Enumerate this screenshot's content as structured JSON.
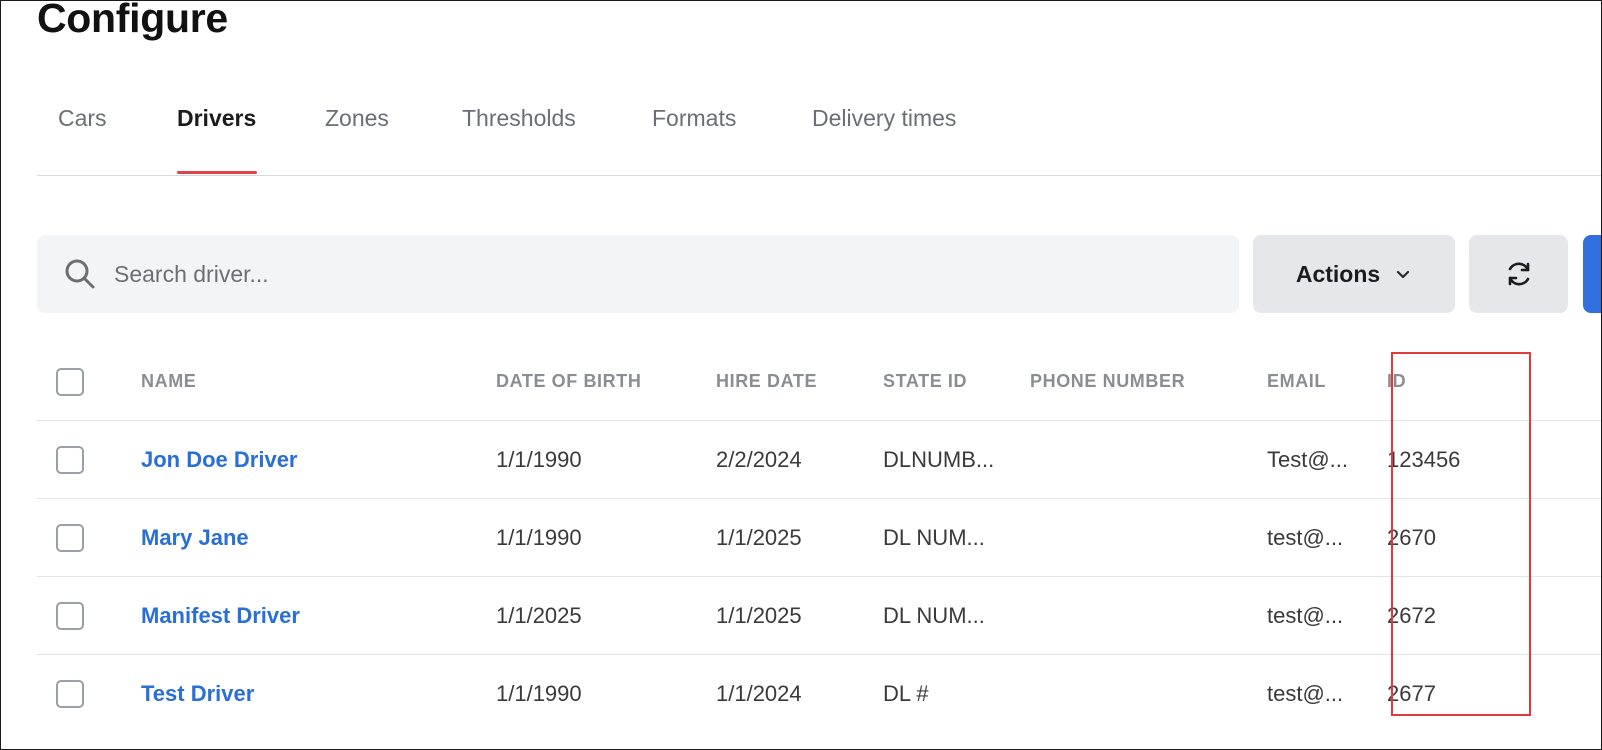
{
  "page": {
    "title": "Configure"
  },
  "tabs": [
    {
      "label": "Cars"
    },
    {
      "label": "Drivers",
      "active": true
    },
    {
      "label": "Zones"
    },
    {
      "label": "Thresholds"
    },
    {
      "label": "Formats"
    },
    {
      "label": "Delivery times"
    }
  ],
  "toolbar": {
    "search_placeholder": "Search driver...",
    "search_value": "",
    "actions_label": "Actions",
    "icons": {
      "search": "search-icon",
      "actions": "chevron-down-icon",
      "refresh": "refresh-icon"
    }
  },
  "table": {
    "columns": [
      "NAME",
      "DATE OF BIRTH",
      "HIRE DATE",
      "STATE ID",
      "PHONE NUMBER",
      "EMAIL",
      "ID"
    ],
    "rows": [
      {
        "name": "Jon Doe Driver",
        "dob": "1/1/1990",
        "hire": "2/2/2024",
        "state_id": "DLNUMB...",
        "phone": "",
        "email": "Test@...",
        "id": "123456"
      },
      {
        "name": "Mary Jane",
        "dob": "1/1/1990",
        "hire": "1/1/2025",
        "state_id": "DL NUM...",
        "phone": "",
        "email": "test@...",
        "id": "2670"
      },
      {
        "name": "Manifest Driver",
        "dob": "1/1/2025",
        "hire": "1/1/2025",
        "state_id": "DL NUM...",
        "phone": "",
        "email": "test@...",
        "id": "2672"
      },
      {
        "name": "Test Driver",
        "dob": "1/1/1990",
        "hire": "1/1/2024",
        "state_id": "DL #",
        "phone": "",
        "email": "test@...",
        "id": "2677"
      }
    ]
  },
  "colors": {
    "accent_tab": "#e2424a",
    "link": "#2a6fd6",
    "primary_button": "#2f6fde",
    "highlight": "#e03a3a"
  }
}
